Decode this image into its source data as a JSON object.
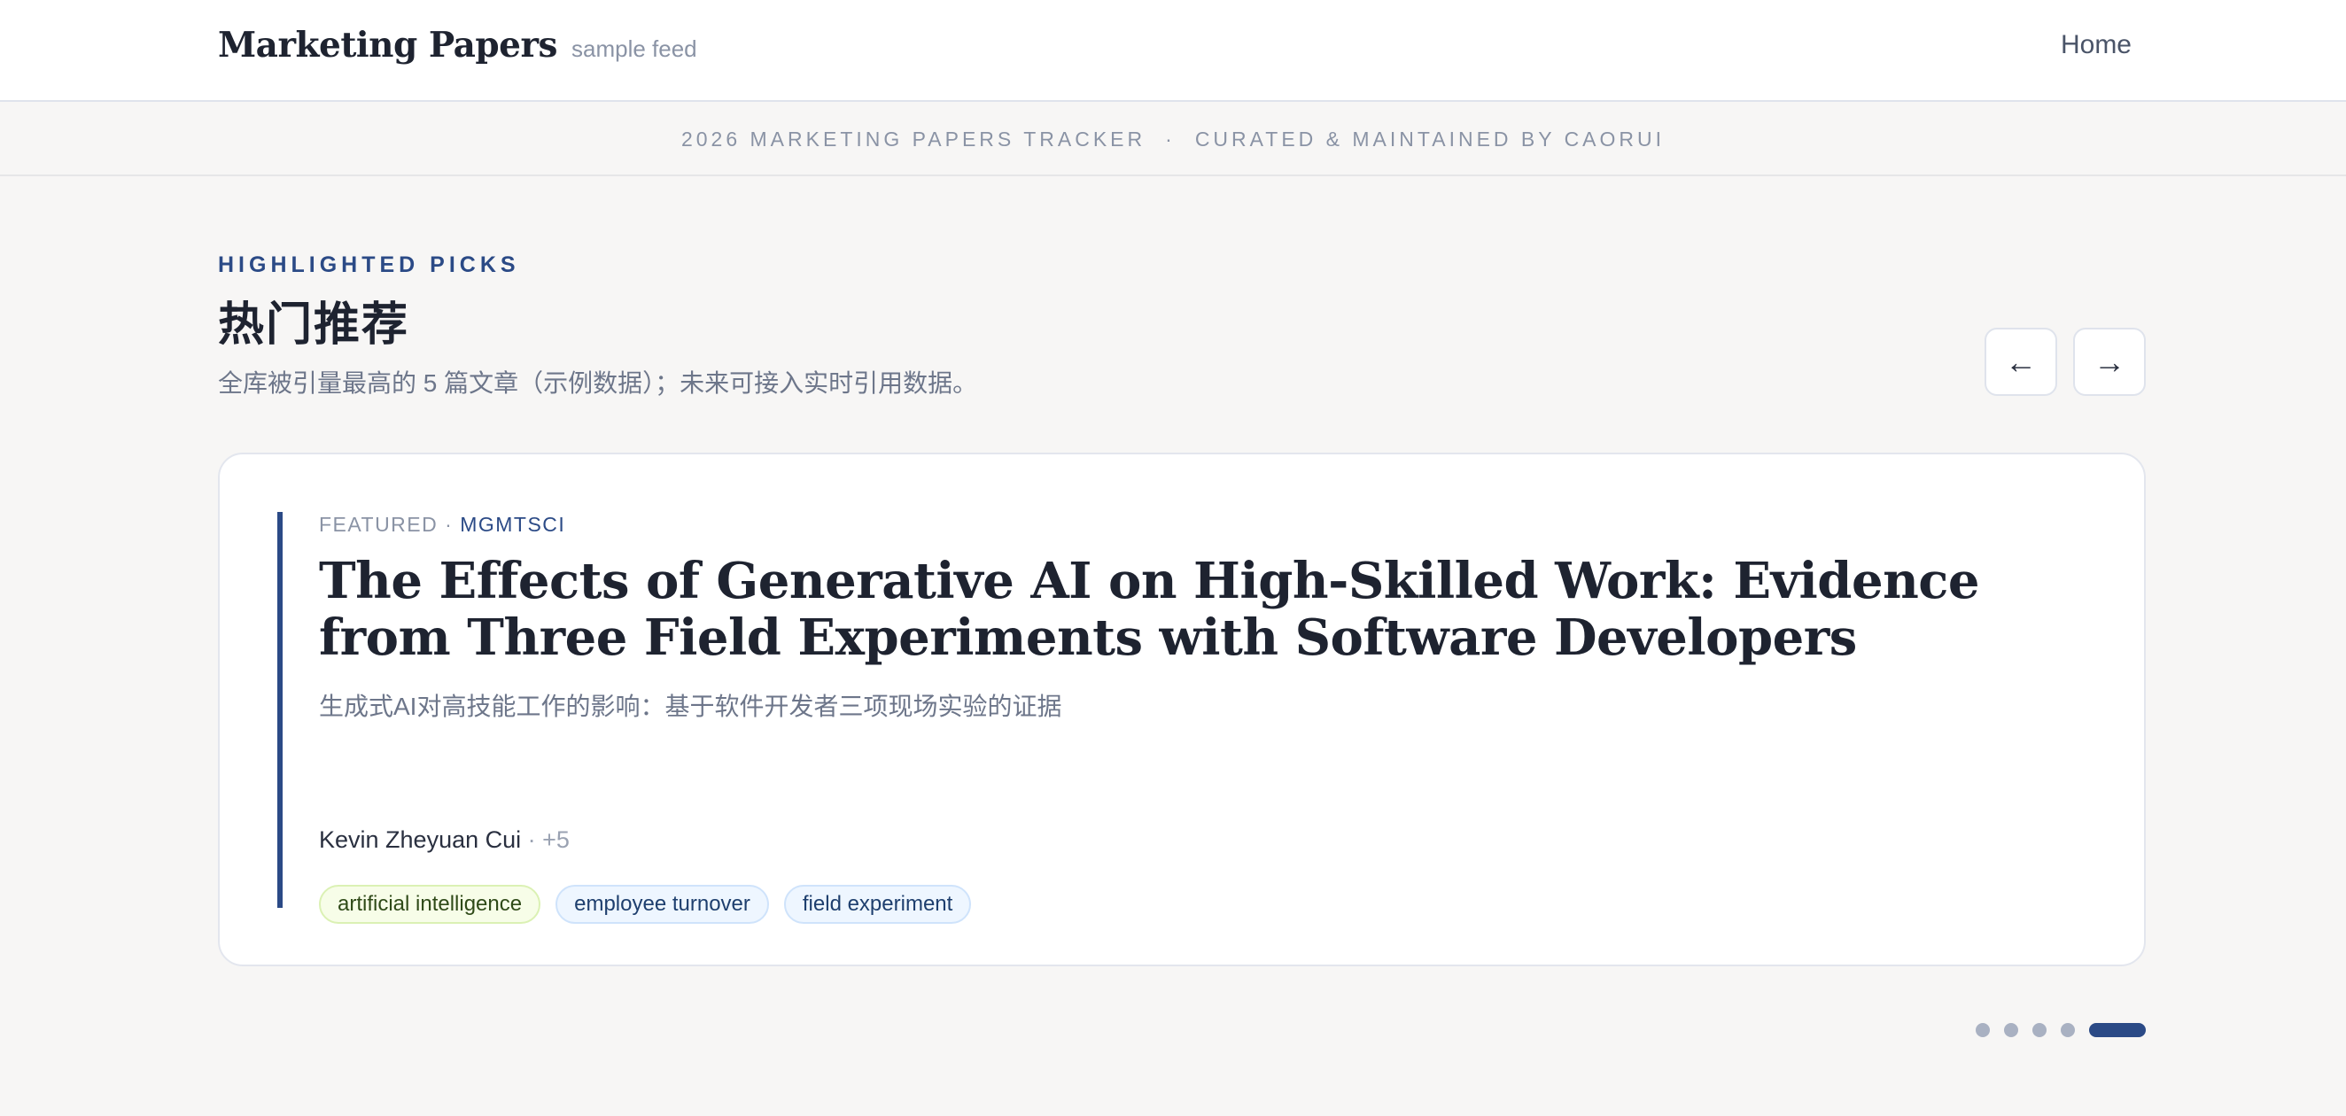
{
  "header": {
    "brand_title": "Marketing Papers",
    "brand_subtitle": "sample feed",
    "nav": {
      "home_label": "Home"
    }
  },
  "tracker_bar": {
    "left_text": "2026 MARKETING PAPERS TRACKER",
    "separator": "·",
    "right_text": "CURATED & MAINTAINED BY CAORUI"
  },
  "highlighted": {
    "eyebrow": "HIGHLIGHTED PICKS",
    "title": "热门推荐",
    "description": "全库被引量最高的 5 篇文章（示例数据）；未来可接入实时引用数据。",
    "prev_label": "←",
    "next_label": "→",
    "card": {
      "kicker_label": "FEATURED",
      "kicker_separator": " · ",
      "journal": "MGMTSCI",
      "title": "The Effects of Generative AI on High-Skilled Work: Evidence from Three Field Experiments with Software Developers",
      "subtitle_zh": "生成式AI对高技能工作的影响：基于软件开发者三项现场实验的证据",
      "first_author": "Kevin Zheyuan Cui",
      "more_authors": " · +5",
      "tags": [
        {
          "label": "artificial intelligence",
          "color": "#f7fde8"
        },
        {
          "label": "employee turnover",
          "color": "#eef6ff"
        },
        {
          "label": "field experiment",
          "color": "#eef6ff"
        }
      ]
    },
    "carousel": {
      "total": 5,
      "active_index": 5
    }
  },
  "colors": {
    "accent": "#2b4a86",
    "background": "#f7f6f5",
    "card_background": "#ffffff",
    "muted_text": "#8a93a5"
  }
}
